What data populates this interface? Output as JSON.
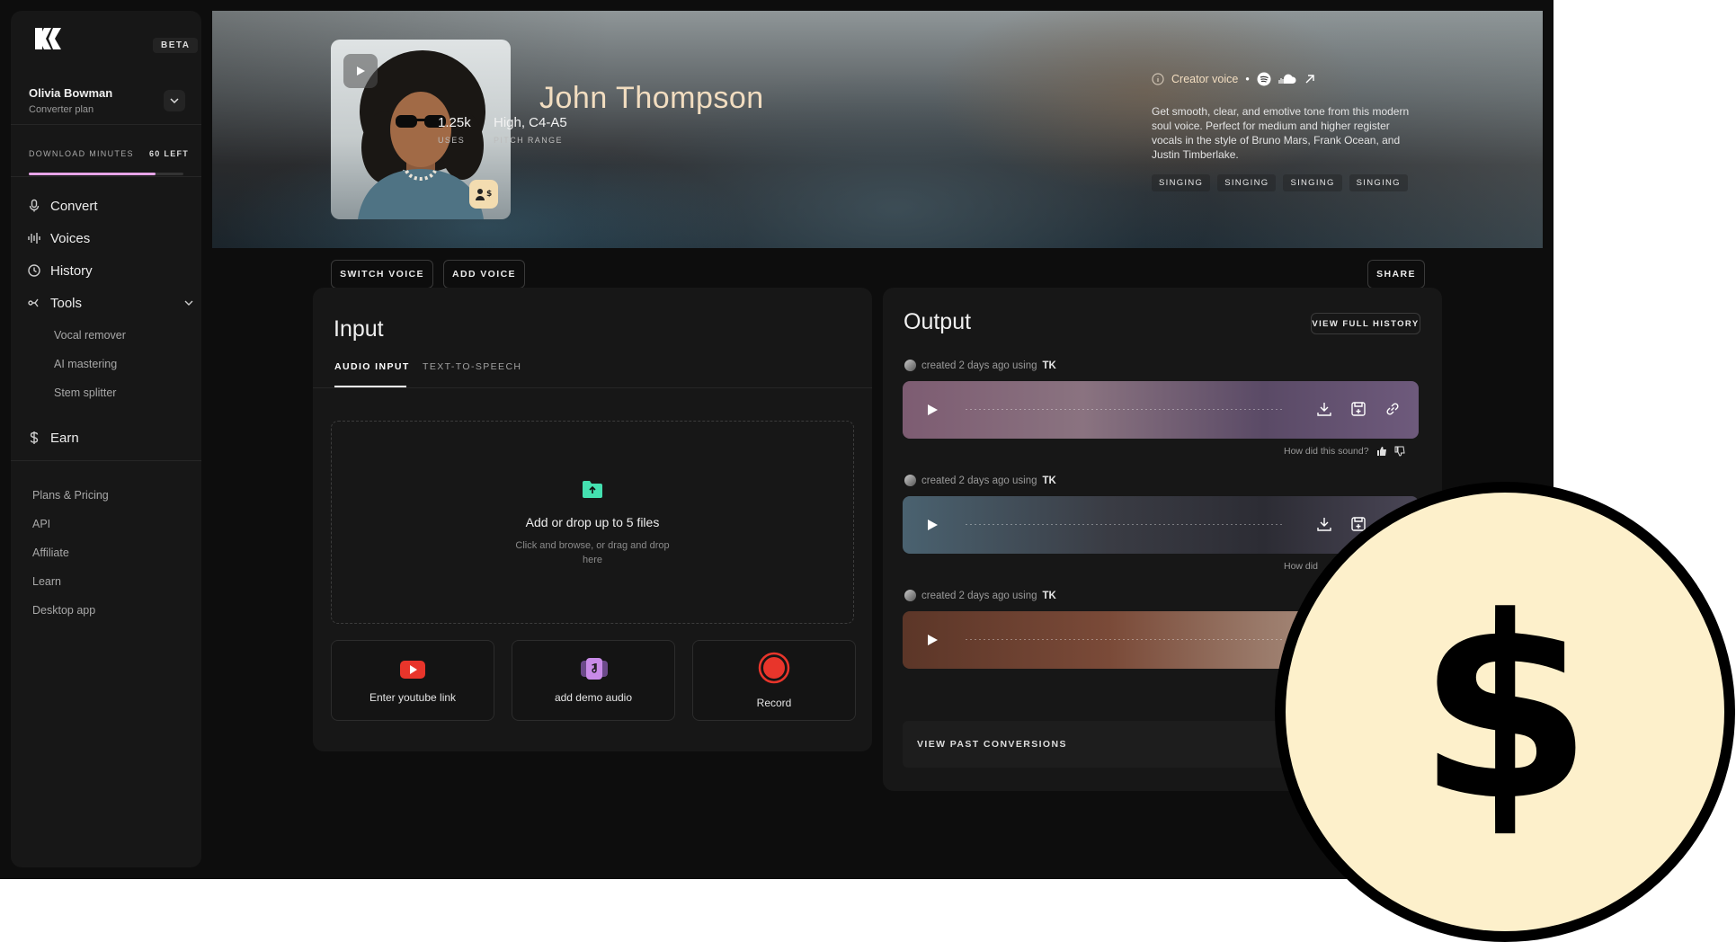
{
  "sidebar": {
    "beta_label": "BETA",
    "user": {
      "name": "Olivia Bowman",
      "plan": "Converter plan"
    },
    "download": {
      "label": "DOWNLOAD MINUTES",
      "left": "60 LEFT",
      "progress_fraction": 0.82
    },
    "nav": {
      "convert": "Convert",
      "voices": "Voices",
      "history": "History",
      "tools": "Tools",
      "earn": "Earn"
    },
    "tools_sub": {
      "vocal_remover": "Vocal remover",
      "ai_mastering": "AI mastering",
      "stem_splitter": "Stem splitter"
    },
    "links": {
      "plans": "Plans & Pricing",
      "api": "API",
      "affiliate": "Affiliate",
      "learn": "Learn",
      "desktop": "Desktop app"
    }
  },
  "hero": {
    "name": "John Thompson",
    "uses_value": "1.25k",
    "uses_label": "USES",
    "pitch_value": "High, C4-A5",
    "pitch_label": "PITCH RANGE",
    "creator_label": "Creator voice",
    "description": "Get smooth, clear, and emotive tone from this modern soul voice. Perfect for medium and higher register vocals in the style of Bruno Mars, Frank Ocean, and Justin Timberlake.",
    "tags": [
      "SINGING",
      "SINGING",
      "SINGING",
      "SINGING"
    ]
  },
  "actions": {
    "switch_voice": "SWITCH VOICE",
    "add_voice": "ADD VOICE",
    "share": "SHARE"
  },
  "input": {
    "title": "Input",
    "tab_audio": "AUDIO INPUT",
    "tab_tts": "TEXT-TO-SPEECH",
    "drop_title": "Add or drop up to 5 files",
    "drop_sub": "Click and browse,  or drag and drop here",
    "youtube": "Enter youtube link",
    "demo": "add demo audio",
    "record": "Record"
  },
  "output": {
    "title": "Output",
    "view_history": "VIEW FULL HISTORY",
    "items": [
      {
        "meta": "created 2 days ago using",
        "by": "TK",
        "feedback": "How did this sound?"
      },
      {
        "meta": "created 2 days ago using",
        "by": "TK",
        "feedback": "How did"
      },
      {
        "meta": "created 2 days ago using",
        "by": "TK"
      }
    ],
    "past": "VIEW PAST CONVERSIONS"
  },
  "badge": {
    "symbol": "$"
  },
  "colors": {
    "accent_gold": "#f2ddc0",
    "progress_pink": "#e7a4e8",
    "coin_fill": "#fdf0cb",
    "youtube_red": "#e8352b",
    "upload_green": "#44e0b0"
  }
}
